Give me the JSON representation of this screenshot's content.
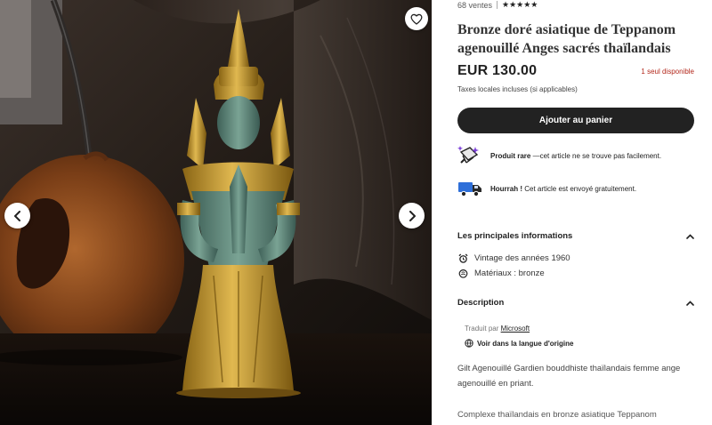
{
  "listing": {
    "sales_count": "68 ventes",
    "rating_label": "★★★★★",
    "title": "Bronze doré asiatique de Teppanom agenouillé Anges sacrés thaïlandais",
    "price": "EUR 130.00",
    "stock_note": "1 seul disponible",
    "tax_note": "Taxes locales incluses (si applicables)",
    "add_to_cart_label": "Ajouter au panier"
  },
  "features": [
    {
      "icon": "rare-item-icon",
      "title": "Produit rare",
      "text": " —cet article ne se trouve pas facilement."
    },
    {
      "icon": "delivery-truck-icon",
      "title": "Hourrah !",
      "text": " Cet article est envoyé gratuitement."
    }
  ],
  "highlights": {
    "heading": "Les principales informations",
    "items": [
      {
        "icon": "vintage-alarm-icon",
        "text": "Vintage des années 1960"
      },
      {
        "icon": "material-icon",
        "text": "Matériaux : bronze"
      }
    ]
  },
  "description": {
    "heading": "Description",
    "translated_prefix": "Traduit par ",
    "translator": "Microsoft",
    "original_language_label": "Voir dans la langue d'origine",
    "paragraph_1": "Gilt Agenouillé Gardien bouddhiste thaïlandais femme ange agenouillé en priant.",
    "paragraph_2": "Complexe thaïlandais en bronze asiatique Teppanom"
  },
  "colors": {
    "accent_dark": "#222222",
    "stock_red": "#b3271b",
    "gold": "#c9a23a",
    "patina": "#5f8a7c"
  }
}
